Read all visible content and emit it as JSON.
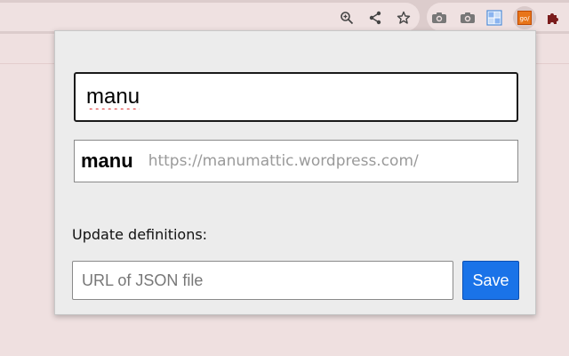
{
  "browser": {
    "toolbar_icons": [
      "zoom-icon",
      "share-icon",
      "bookmark-star-icon"
    ],
    "extension_icons": [
      "camera-icon",
      "camera-icon",
      "grid-icon",
      "golink-icon",
      "puzzle-icon"
    ],
    "golink_badge": "go/"
  },
  "popup": {
    "search_value": "manu",
    "suggestion": {
      "name": "manu",
      "url": "https://manumattic.wordpress.com/"
    },
    "update_label": "Update definitions:",
    "json_placeholder": "URL of JSON file",
    "json_value": "",
    "save_label": "Save"
  },
  "colors": {
    "accent": "#1a73e8",
    "page_background": "#efe0e0",
    "popup_background": "#ececec",
    "suggestion_url": "#9a9a9a"
  }
}
